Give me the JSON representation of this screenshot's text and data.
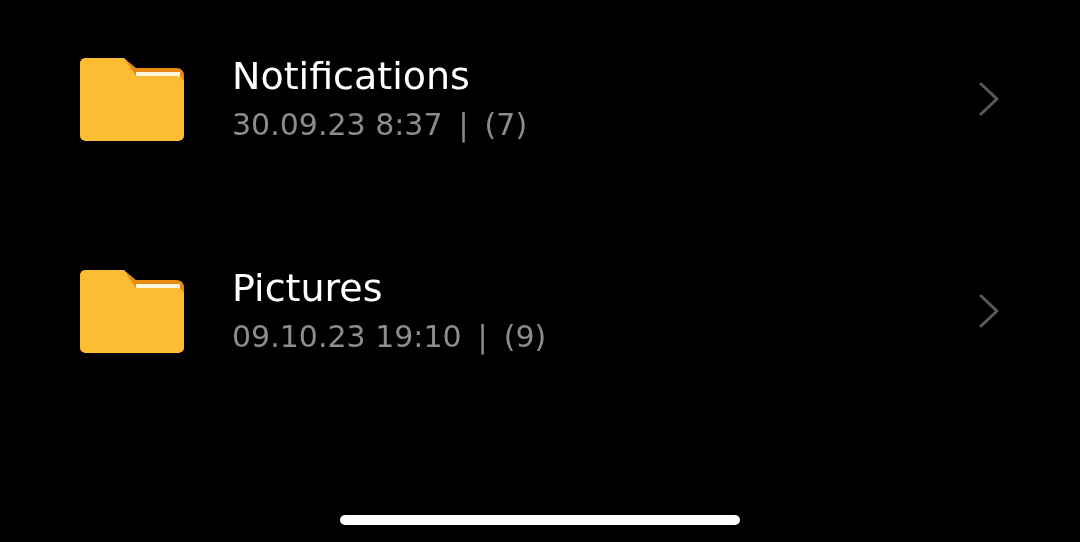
{
  "folders": [
    {
      "name": "Notifications",
      "date": "30.09.23 8:37",
      "separator": "|",
      "count": "(7)"
    },
    {
      "name": "Pictures",
      "date": "09.10.23 19:10",
      "separator": "|",
      "count": "(9)"
    }
  ]
}
